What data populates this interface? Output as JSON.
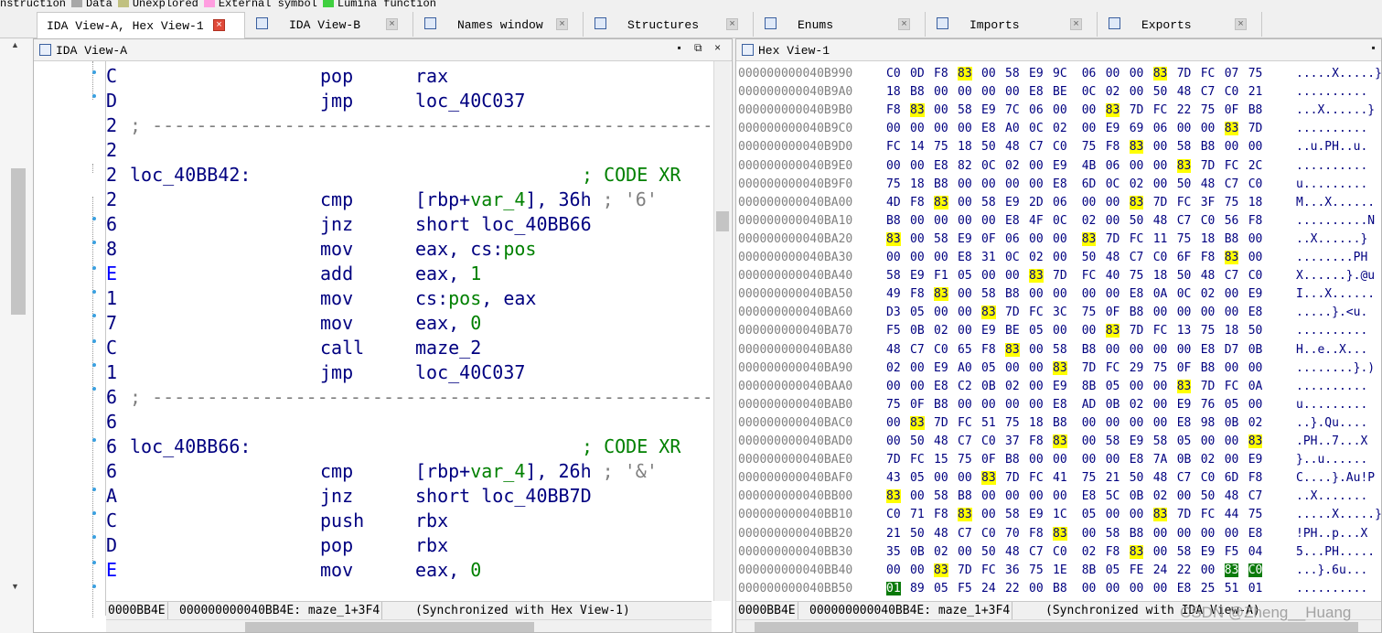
{
  "legend": [
    {
      "label": "nstruction",
      "color": ""
    },
    {
      "label": "Data",
      "color": "#a8a8a8"
    },
    {
      "label": "Unexplored",
      "color": "#c0c080"
    },
    {
      "label": "External symbol",
      "color": "#ff9ee0"
    },
    {
      "label": "Lumina function",
      "color": "#40d040"
    }
  ],
  "tabs": [
    {
      "label": "IDA View-A, Hex View-1",
      "icon": "",
      "active": true
    },
    {
      "label": "IDA View-B",
      "icon": "graph-view-icon"
    },
    {
      "label": "Names window",
      "icon": "names-icon"
    },
    {
      "label": "Structures",
      "icon": "structures-icon"
    },
    {
      "label": "Enums",
      "icon": "enums-icon"
    },
    {
      "label": "Imports",
      "icon": "imports-icon"
    },
    {
      "label": "Exports",
      "icon": "exports-icon"
    }
  ],
  "tab_close": "×",
  "ida_view": {
    "title": "IDA View-A",
    "pin": "▪",
    "float": "⧉",
    "close": "×",
    "lines": [
      {
        "seg": "C",
        "mnem": "pop",
        "ops": [
          {
            "t": "rax",
            "c": "op"
          }
        ]
      },
      {
        "seg": "D",
        "mnem": "jmp",
        "ops": [
          {
            "t": "loc_40C037",
            "c": "op"
          }
        ]
      },
      {
        "seg": "2",
        "sep": "; ---------------------------------------------------------"
      },
      {
        "seg": "2"
      },
      {
        "seg": "2",
        "label": "loc_40BB42:",
        "xref": "; CODE XR"
      },
      {
        "seg": "2",
        "mnem": "cmp",
        "ops": [
          {
            "t": "[rbp+",
            "c": "op"
          },
          {
            "t": "var_4",
            "c": "vrt"
          },
          {
            "t": "], 36h",
            "c": "op"
          },
          {
            "t": " ; '6'",
            "c": "cm"
          }
        ]
      },
      {
        "seg": "6",
        "mnem": "jnz",
        "ops": [
          {
            "t": "short loc_40BB66",
            "c": "op"
          }
        ]
      },
      {
        "seg": "8",
        "mnem": "mov",
        "ops": [
          {
            "t": "eax, cs:",
            "c": "op"
          },
          {
            "t": "pos",
            "c": "nm"
          }
        ]
      },
      {
        "seg": "E",
        "mnem": "add",
        "ops": [
          {
            "t": "eax, ",
            "c": "op"
          },
          {
            "t": "1",
            "c": "nm"
          }
        ]
      },
      {
        "seg": "1",
        "mnem": "mov",
        "ops": [
          {
            "t": "cs:",
            "c": "op"
          },
          {
            "t": "pos",
            "c": "nm"
          },
          {
            "t": ", eax",
            "c": "op"
          }
        ]
      },
      {
        "seg": "7",
        "mnem": "mov",
        "ops": [
          {
            "t": "eax, ",
            "c": "op"
          },
          {
            "t": "0",
            "c": "nm"
          }
        ]
      },
      {
        "seg": "C",
        "mnem": "call",
        "ops": [
          {
            "t": "maze_2",
            "c": "op"
          }
        ]
      },
      {
        "seg": "1",
        "mnem": "jmp",
        "ops": [
          {
            "t": "loc_40C037",
            "c": "op"
          }
        ]
      },
      {
        "seg": "6",
        "sep": "; ---------------------------------------------------------"
      },
      {
        "seg": "6"
      },
      {
        "seg": "6",
        "label": "loc_40BB66:",
        "xref": "; CODE XR"
      },
      {
        "seg": "6",
        "mnem": "cmp",
        "ops": [
          {
            "t": "[rbp+",
            "c": "op"
          },
          {
            "t": "var_4",
            "c": "vrt"
          },
          {
            "t": "], 26h",
            "c": "op"
          },
          {
            "t": " ; '&'",
            "c": "cm"
          }
        ]
      },
      {
        "seg": "A",
        "mnem": "jnz",
        "ops": [
          {
            "t": "short loc_40BB7D",
            "c": "op"
          }
        ]
      },
      {
        "seg": "C",
        "mnem": "push",
        "ops": [
          {
            "t": "rbx",
            "c": "op"
          }
        ]
      },
      {
        "seg": "D",
        "mnem": "pop",
        "ops": [
          {
            "t": "rbx",
            "c": "op"
          }
        ]
      },
      {
        "seg": "E",
        "mnem": "mov",
        "ops": [
          {
            "t": "eax, ",
            "c": "op"
          },
          {
            "t": "0",
            "c": "nm"
          }
        ]
      }
    ],
    "status_offset": "0000BB4E",
    "status_addr": "000000000040BB4E: maze_1+3F4",
    "status_sync": "(Synchronized with Hex View-1)"
  },
  "hex_view": {
    "title": "Hex View-1",
    "rows": [
      {
        "a": "000000000040B990",
        "b": [
          "C0",
          "0D",
          "F8",
          "83",
          "00",
          "58",
          "E9",
          "9C",
          "06",
          "00",
          "00",
          "83",
          "7D",
          "FC",
          "07",
          "75"
        ],
        "s": ".....X.....}."
      },
      {
        "a": "000000000040B9A0",
        "b": [
          "18",
          "B8",
          "00",
          "00",
          "00",
          "00",
          "E8",
          "BE",
          "0C",
          "02",
          "00",
          "50",
          "48",
          "C7",
          "C0",
          "21"
        ],
        "s": ".........."
      },
      {
        "a": "000000000040B9B0",
        "b": [
          "F8",
          "83",
          "00",
          "58",
          "E9",
          "7C",
          "06",
          "00",
          "00",
          "83",
          "7D",
          "FC",
          "22",
          "75",
          "0F",
          "B8"
        ],
        "s": "...X......}"
      },
      {
        "a": "000000000040B9C0",
        "b": [
          "00",
          "00",
          "00",
          "00",
          "E8",
          "A0",
          "0C",
          "02",
          "00",
          "E9",
          "69",
          "06",
          "00",
          "00",
          "83",
          "7D"
        ],
        "s": ".........."
      },
      {
        "a": "000000000040B9D0",
        "b": [
          "FC",
          "14",
          "75",
          "18",
          "50",
          "48",
          "C7",
          "C0",
          "75",
          "F8",
          "83",
          "00",
          "58",
          "B8",
          "00",
          "00"
        ],
        "s": "..u.PH..u."
      },
      {
        "a": "000000000040B9E0",
        "b": [
          "00",
          "00",
          "E8",
          "82",
          "0C",
          "02",
          "00",
          "E9",
          "4B",
          "06",
          "00",
          "00",
          "83",
          "7D",
          "FC",
          "2C"
        ],
        "s": ".........."
      },
      {
        "a": "000000000040B9F0",
        "b": [
          "75",
          "18",
          "B8",
          "00",
          "00",
          "00",
          "00",
          "E8",
          "6D",
          "0C",
          "02",
          "00",
          "50",
          "48",
          "C7",
          "C0"
        ],
        "s": "u........."
      },
      {
        "a": "000000000040BA00",
        "b": [
          "4D",
          "F8",
          "83",
          "00",
          "58",
          "E9",
          "2D",
          "06",
          "00",
          "00",
          "83",
          "7D",
          "FC",
          "3F",
          "75",
          "18"
        ],
        "s": "M...X......"
      },
      {
        "a": "000000000040BA10",
        "b": [
          "B8",
          "00",
          "00",
          "00",
          "00",
          "E8",
          "4F",
          "0C",
          "02",
          "00",
          "50",
          "48",
          "C7",
          "C0",
          "56",
          "F8"
        ],
        "s": "..........N"
      },
      {
        "a": "000000000040BA20",
        "b": [
          "83",
          "00",
          "58",
          "E9",
          "0F",
          "06",
          "00",
          "00",
          "83",
          "7D",
          "FC",
          "11",
          "75",
          "18",
          "B8",
          "00"
        ],
        "s": "..X......}"
      },
      {
        "a": "000000000040BA30",
        "b": [
          "00",
          "00",
          "00",
          "E8",
          "31",
          "0C",
          "02",
          "00",
          "50",
          "48",
          "C7",
          "C0",
          "6F",
          "F8",
          "83",
          "00"
        ],
        "s": "........PH"
      },
      {
        "a": "000000000040BA40",
        "b": [
          "58",
          "E9",
          "F1",
          "05",
          "00",
          "00",
          "83",
          "7D",
          "FC",
          "40",
          "75",
          "18",
          "50",
          "48",
          "C7",
          "C0"
        ],
        "s": "X......}.@u"
      },
      {
        "a": "000000000040BA50",
        "b": [
          "49",
          "F8",
          "83",
          "00",
          "58",
          "B8",
          "00",
          "00",
          "00",
          "00",
          "E8",
          "0A",
          "0C",
          "02",
          "00",
          "E9"
        ],
        "s": "I...X......"
      },
      {
        "a": "000000000040BA60",
        "b": [
          "D3",
          "05",
          "00",
          "00",
          "83",
          "7D",
          "FC",
          "3C",
          "75",
          "0F",
          "B8",
          "00",
          "00",
          "00",
          "00",
          "E8"
        ],
        "s": ".....}.<u."
      },
      {
        "a": "000000000040BA70",
        "b": [
          "F5",
          "0B",
          "02",
          "00",
          "E9",
          "BE",
          "05",
          "00",
          "00",
          "83",
          "7D",
          "FC",
          "13",
          "75",
          "18",
          "50"
        ],
        "s": ".........."
      },
      {
        "a": "000000000040BA80",
        "b": [
          "48",
          "C7",
          "C0",
          "65",
          "F8",
          "83",
          "00",
          "58",
          "B8",
          "00",
          "00",
          "00",
          "00",
          "E8",
          "D7",
          "0B"
        ],
        "s": "H..e..X..."
      },
      {
        "a": "000000000040BA90",
        "b": [
          "02",
          "00",
          "E9",
          "A0",
          "05",
          "00",
          "00",
          "83",
          "7D",
          "FC",
          "29",
          "75",
          "0F",
          "B8",
          "00",
          "00"
        ],
        "s": "........}.)"
      },
      {
        "a": "000000000040BAA0",
        "b": [
          "00",
          "00",
          "E8",
          "C2",
          "0B",
          "02",
          "00",
          "E9",
          "8B",
          "05",
          "00",
          "00",
          "83",
          "7D",
          "FC",
          "0A"
        ],
        "s": ".........."
      },
      {
        "a": "000000000040BAB0",
        "b": [
          "75",
          "0F",
          "B8",
          "00",
          "00",
          "00",
          "00",
          "E8",
          "AD",
          "0B",
          "02",
          "00",
          "E9",
          "76",
          "05",
          "00"
        ],
        "s": "u........."
      },
      {
        "a": "000000000040BAC0",
        "b": [
          "00",
          "83",
          "7D",
          "FC",
          "51",
          "75",
          "18",
          "B8",
          "00",
          "00",
          "00",
          "00",
          "E8",
          "98",
          "0B",
          "02"
        ],
        "s": "..}.Qu...."
      },
      {
        "a": "000000000040BAD0",
        "b": [
          "00",
          "50",
          "48",
          "C7",
          "C0",
          "37",
          "F8",
          "83",
          "00",
          "58",
          "E9",
          "58",
          "05",
          "00",
          "00",
          "83"
        ],
        "s": ".PH..7...X"
      },
      {
        "a": "000000000040BAE0",
        "b": [
          "7D",
          "FC",
          "15",
          "75",
          "0F",
          "B8",
          "00",
          "00",
          "00",
          "00",
          "E8",
          "7A",
          "0B",
          "02",
          "00",
          "E9"
        ],
        "s": "}..u......"
      },
      {
        "a": "000000000040BAF0",
        "b": [
          "43",
          "05",
          "00",
          "00",
          "83",
          "7D",
          "FC",
          "41",
          "75",
          "21",
          "50",
          "48",
          "C7",
          "C0",
          "6D",
          "F8"
        ],
        "s": "C....}.Au!P"
      },
      {
        "a": "000000000040BB00",
        "b": [
          "83",
          "00",
          "58",
          "B8",
          "00",
          "00",
          "00",
          "00",
          "E8",
          "5C",
          "0B",
          "02",
          "00",
          "50",
          "48",
          "C7"
        ],
        "s": "..X......."
      },
      {
        "a": "000000000040BB10",
        "b": [
          "C0",
          "71",
          "F8",
          "83",
          "00",
          "58",
          "E9",
          "1C",
          "05",
          "00",
          "00",
          "83",
          "7D",
          "FC",
          "44",
          "75"
        ],
        "s": ".....X.....}"
      },
      {
        "a": "000000000040BB20",
        "b": [
          "21",
          "50",
          "48",
          "C7",
          "C0",
          "70",
          "F8",
          "83",
          "00",
          "58",
          "B8",
          "00",
          "00",
          "00",
          "00",
          "E8"
        ],
        "s": "!PH..p...X"
      },
      {
        "a": "000000000040BB30",
        "b": [
          "35",
          "0B",
          "02",
          "00",
          "50",
          "48",
          "C7",
          "C0",
          "02",
          "F8",
          "83",
          "00",
          "58",
          "E9",
          "F5",
          "04"
        ],
        "s": "5...PH....."
      },
      {
        "a": "000000000040BB40",
        "b": [
          "00",
          "00",
          "83",
          "7D",
          "FC",
          "36",
          "75",
          "1E",
          "8B",
          "05",
          "FE",
          "24",
          "22",
          "00",
          "83",
          "C0"
        ],
        "s": "...}.6u..."
      },
      {
        "a": "000000000040BB50",
        "b": [
          "01",
          "89",
          "05",
          "F5",
          "24",
          "22",
          "00",
          "B8",
          "00",
          "00",
          "00",
          "00",
          "E8",
          "25",
          "51",
          "01"
        ],
        "s": ".........."
      }
    ],
    "status_offset": "0000BB4E",
    "status_addr": "000000000040BB4E: maze_1+3F4",
    "status_sync": "(Synchronized with IDA View-A)"
  },
  "watermark": "CSDN @Zheng__Huang"
}
